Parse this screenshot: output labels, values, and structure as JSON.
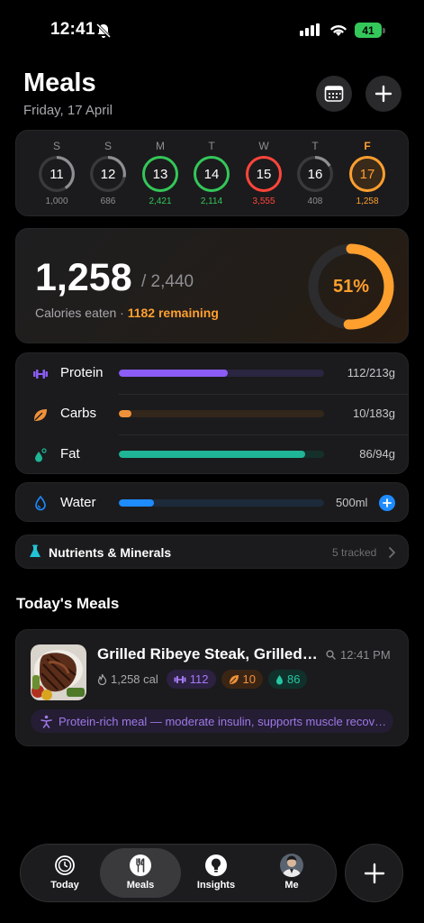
{
  "status_bar": {
    "time": "12:41",
    "battery": "41"
  },
  "header": {
    "title": "Meals",
    "date": "Friday, 17 April",
    "calendar_icon": "calendar-icon",
    "add_icon": "plus-icon"
  },
  "week": [
    {
      "letter": "S",
      "day": "11",
      "calories": "1,000",
      "progress": 0.41,
      "status": "under",
      "today": false
    },
    {
      "letter": "S",
      "day": "12",
      "calories": "686",
      "progress": 0.28,
      "status": "under",
      "today": false
    },
    {
      "letter": "M",
      "day": "13",
      "calories": "2,421",
      "progress": 0.99,
      "status": "on_target",
      "today": false
    },
    {
      "letter": "T",
      "day": "14",
      "calories": "2,114",
      "progress": 0.87,
      "status": "on_target",
      "today": false
    },
    {
      "letter": "W",
      "day": "15",
      "calories": "3,555",
      "progress": 1.0,
      "status": "over",
      "today": false
    },
    {
      "letter": "T",
      "day": "16",
      "calories": "408",
      "progress": 0.17,
      "status": "under",
      "today": false
    },
    {
      "letter": "F",
      "day": "17",
      "calories": "1,258",
      "progress": 0.51,
      "status": "today",
      "today": true
    }
  ],
  "calories": {
    "eaten": "1,258",
    "goal": "/ 2,440",
    "label": "Calories eaten · ",
    "remaining": "1182 remaining",
    "percent_label": "51%",
    "percent": 0.51
  },
  "macros": [
    {
      "name": "Protein",
      "value": "112/213g",
      "fraction": 0.53,
      "color": "#8b5cf6",
      "track": "#2a2540",
      "icon": "dumbbell-icon"
    },
    {
      "name": "Carbs",
      "value": "10/183g",
      "fraction": 0.06,
      "color": "#f0913a",
      "track": "#33261b",
      "icon": "leaf-icon"
    },
    {
      "name": "Fat",
      "value": "86/94g",
      "fraction": 0.91,
      "color": "#1fb597",
      "track": "#15302b",
      "icon": "droplet-icon"
    }
  ],
  "water": {
    "name": "Water",
    "value": "500ml",
    "fraction": 0.17,
    "icon": "water-drop-icon"
  },
  "nutrients": {
    "name": "Nutrients & Minerals",
    "count": "5 tracked",
    "icon": "flask-icon"
  },
  "section_title": "Today's Meals",
  "meal": {
    "name": "Grilled Ribeye Steak, Grilled Vegetables",
    "time": "12:41 PM",
    "calories": "1,258 cal",
    "protein": "112",
    "carbs": "10",
    "fat": "86",
    "note": "Protein-rich meal — moderate insulin, supports muscle recovery"
  },
  "tabs": [
    {
      "label": "Today",
      "icon": "clock-icon",
      "active": false
    },
    {
      "label": "Meals",
      "icon": "utensils-icon",
      "active": true
    },
    {
      "label": "Insights",
      "icon": "lightbulb-icon",
      "active": false
    },
    {
      "label": "Me",
      "icon": "avatar",
      "active": false
    }
  ],
  "colors": {
    "accent": "#ff9f2e",
    "green": "#34c759",
    "red": "#ff453a",
    "blue": "#1e8bff"
  }
}
